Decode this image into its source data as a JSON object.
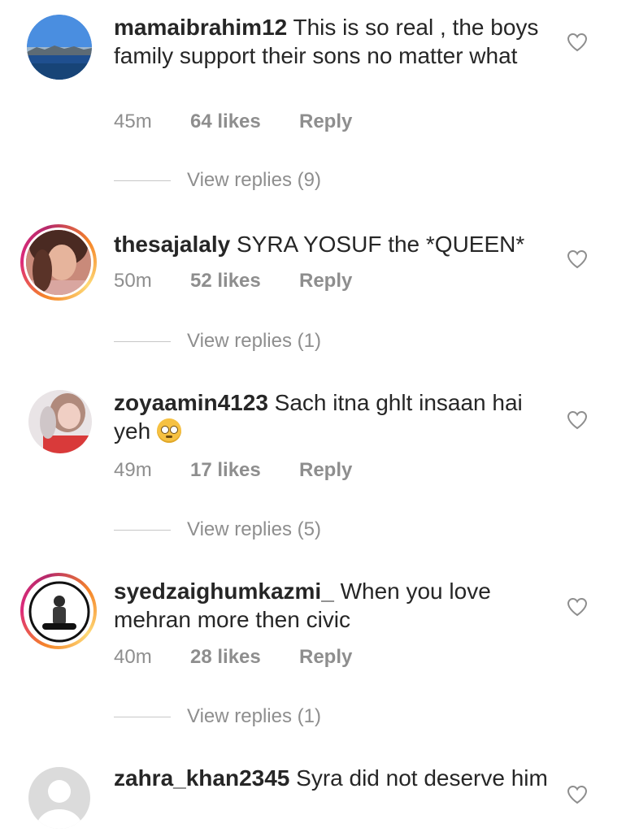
{
  "comments": [
    {
      "username": "mamaibrahim12",
      "text": "This is so real , the boys family support their sons no matter what",
      "time": "45m",
      "likes": "64 likes",
      "reply": "Reply",
      "view_replies": "View replies (9)"
    },
    {
      "username": "thesajalaly",
      "text": "SYRA YOSUF the *QUEEN*",
      "time": "50m",
      "likes": "52 likes",
      "reply": "Reply",
      "view_replies": "View replies (1)"
    },
    {
      "username": "zoyaamin4123",
      "text": "Sach itna ghlt insaan hai yeh",
      "time": "49m",
      "likes": "17 likes",
      "reply": "Reply",
      "view_replies": "View replies (5)"
    },
    {
      "username": "syedzaighumkazmi_",
      "text": "When you love mehran more then civic",
      "time": "40m",
      "likes": "28 likes",
      "reply": "Reply",
      "view_replies": "View replies (1)"
    },
    {
      "username": "zahra_khan2345",
      "text": "Syra did not deserve him"
    }
  ],
  "icons": {
    "like": "heart-outline-icon",
    "emoji": "pleading-face-emoji"
  },
  "colors": {
    "text": "#262626",
    "secondary": "#8e8e8e",
    "story_ring_start": "#f58529",
    "story_ring_end": "#dd2a7b"
  }
}
